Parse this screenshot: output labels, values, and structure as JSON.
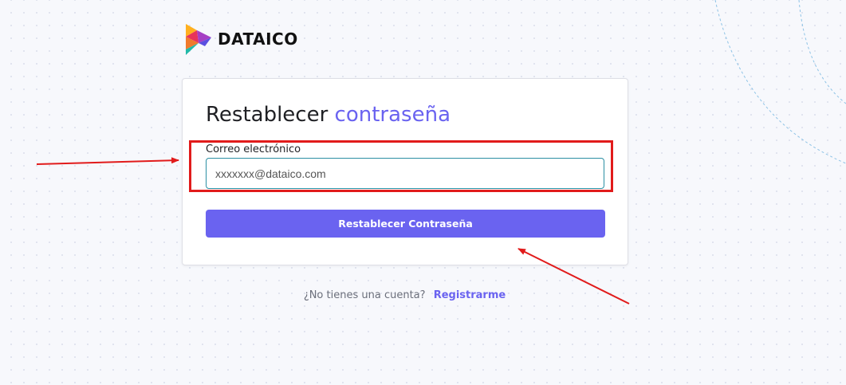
{
  "brand": {
    "name": "DATAICO",
    "logo_icon": "dataico-triangles-icon"
  },
  "card": {
    "title_main": "Restablecer",
    "title_accent": "contraseña"
  },
  "form": {
    "email_label": "Correo electrónico",
    "email_placeholder": "xxxxxxx@dataico.com",
    "email_value": "",
    "submit_label": "Restablecer Contraseña"
  },
  "footer": {
    "prompt": "¿No tienes una cuenta?",
    "signup_link": "Registrarme"
  },
  "colors": {
    "accent": "#6a63f0",
    "annotation": "#e11b1b",
    "input_border": "#2b8fa3"
  }
}
